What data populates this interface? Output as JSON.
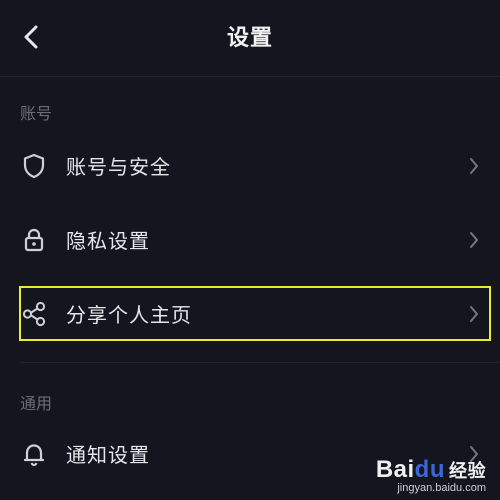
{
  "header": {
    "title": "设置",
    "back_icon": "chevron-left-icon"
  },
  "sections": {
    "account": {
      "title": "账号",
      "items": [
        {
          "label": "账号与安全",
          "icon": "shield-icon"
        },
        {
          "label": "隐私设置",
          "icon": "lock-icon"
        },
        {
          "label": "分享个人主页",
          "icon": "share-icon",
          "highlighted": true
        }
      ]
    },
    "general": {
      "title": "通用",
      "items": [
        {
          "label": "通知设置",
          "icon": "bell-icon"
        }
      ]
    }
  },
  "watermark": {
    "brand": "Bai",
    "brand_paw": "du",
    "brand_cn": "经验",
    "url": "jingyan.baidu.com"
  },
  "colors": {
    "background": "#14151f",
    "text": "#e6e6ea",
    "section_title": "#6c6d78",
    "highlight_border": "#ecec2c"
  }
}
